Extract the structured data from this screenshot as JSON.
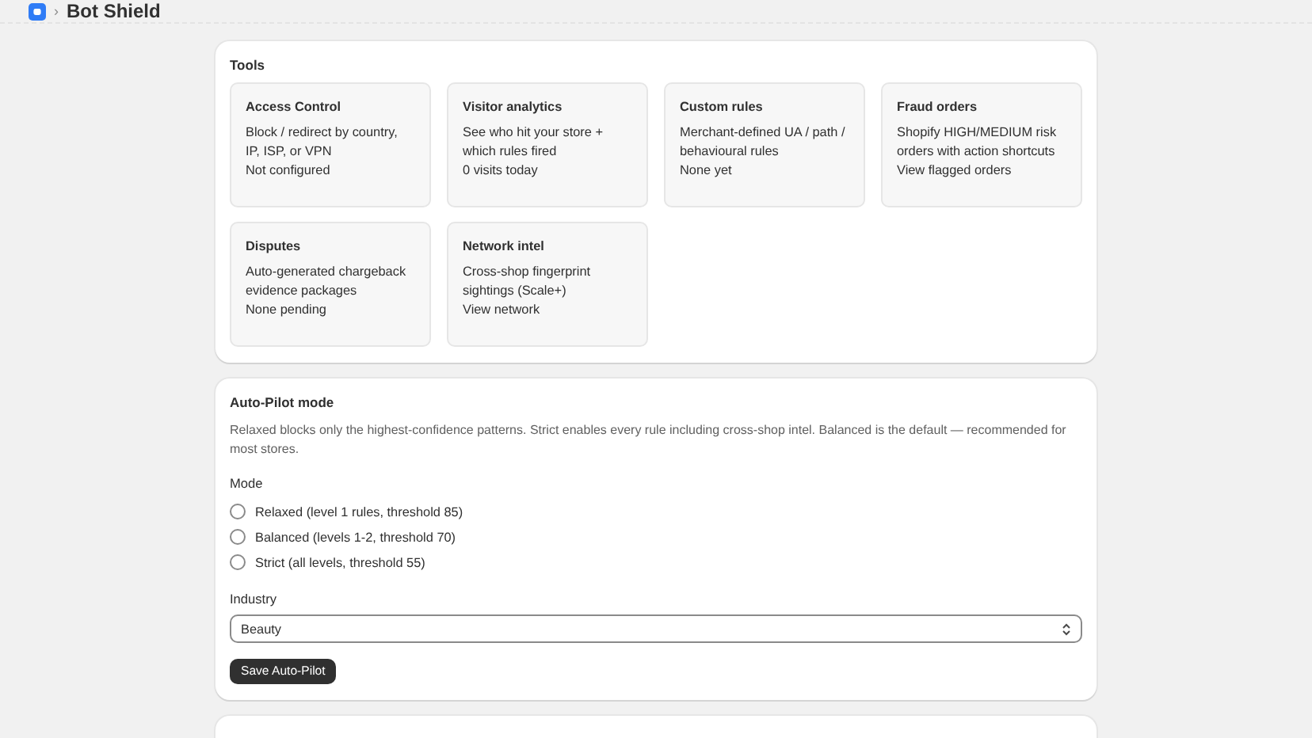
{
  "header": {
    "title": "Bot Shield",
    "separator": "›"
  },
  "tools": {
    "title": "Tools",
    "items": [
      {
        "title": "Access Control",
        "description": "Block / redirect by country, IP, ISP, or VPN",
        "status": "Not configured"
      },
      {
        "title": "Visitor analytics",
        "description": "See who hit your store + which rules fired",
        "status": "0 visits today"
      },
      {
        "title": "Custom rules",
        "description": "Merchant-defined UA / path / behavioural rules",
        "status": "None yet"
      },
      {
        "title": "Fraud orders",
        "description": "Shopify HIGH/MEDIUM risk orders with action shortcuts",
        "status": "View flagged orders"
      },
      {
        "title": "Disputes",
        "description": "Auto-generated chargeback evidence packages",
        "status": "None pending"
      },
      {
        "title": "Network intel",
        "description": "Cross-shop fingerprint sightings (Scale+)",
        "status": "View network"
      }
    ]
  },
  "autopilot": {
    "title": "Auto-Pilot mode",
    "description": "Relaxed blocks only the highest-confidence patterns. Strict enables every rule including cross-shop intel. Balanced is the default — recommended for most stores.",
    "mode_label": "Mode",
    "modes": [
      {
        "label": "Relaxed (level 1 rules, threshold 85)",
        "selected": false
      },
      {
        "label": "Balanced (levels 1-2, threshold 70)",
        "selected": false
      },
      {
        "label": "Strict (all levels, threshold 55)",
        "selected": false
      }
    ],
    "industry_label": "Industry",
    "industry_value": "Beauty",
    "save_button": "Save Auto-Pilot"
  }
}
